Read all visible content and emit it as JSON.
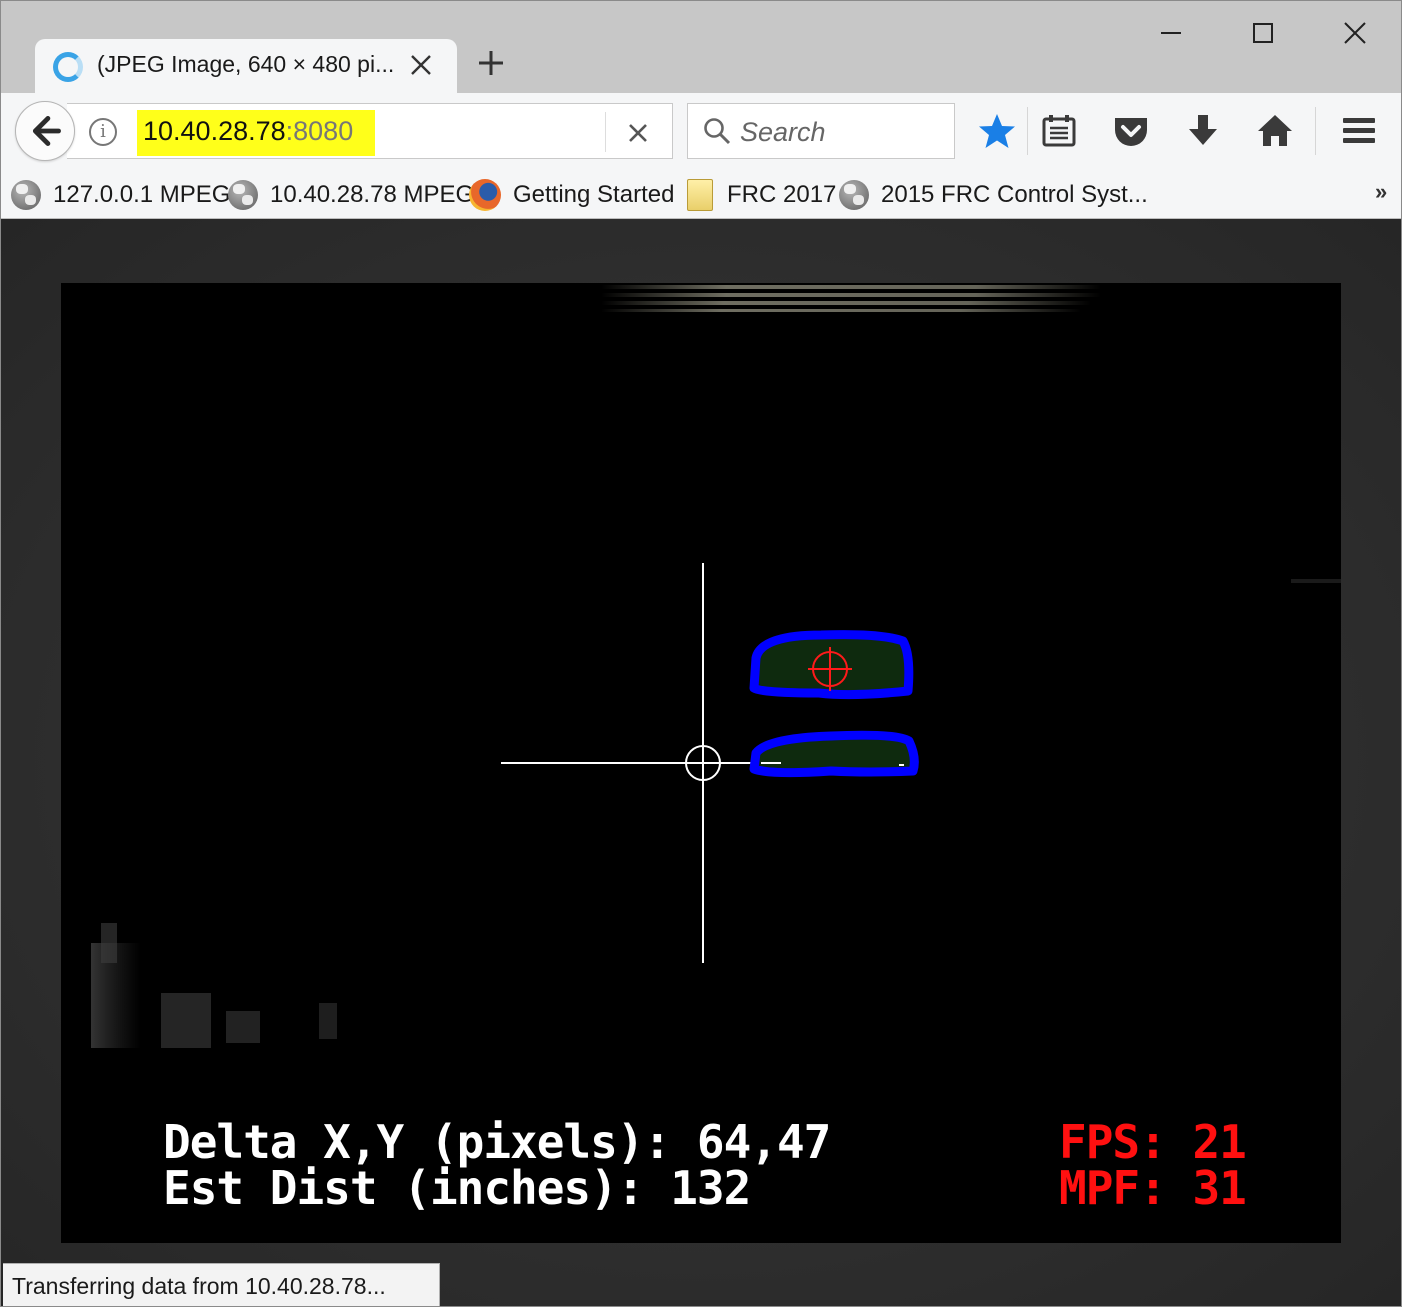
{
  "tab": {
    "title": "(JPEG Image, 640 × 480 pi..."
  },
  "nav": {
    "url_host": "10.40.28.78",
    "url_port": ":8080",
    "search_placeholder": "Search"
  },
  "bookmarks": [
    {
      "label": "127.0.0.1 MPEG",
      "icon": "globe-icon"
    },
    {
      "label": "10.40.28.78 MPEG",
      "icon": "globe-icon"
    },
    {
      "label": "Getting Started",
      "icon": "firefox-icon"
    },
    {
      "label": "FRC 2017",
      "icon": "folder-icon"
    },
    {
      "label": "2015 FRC Control Syst...",
      "icon": "globe-icon"
    }
  ],
  "bookmarks_overflow": "»",
  "camera": {
    "delta_line": "Delta X,Y (pixels): 64,47",
    "dist_line": "Est Dist (inches): 132",
    "fps_line": "FPS: 21",
    "mpf_line": "MPF: 31"
  },
  "status": {
    "text": "Transferring data from 10.40.28.78..."
  },
  "colors": {
    "accent_blue": "#1a7fe6",
    "url_highlight": "#ffff1a",
    "target_outline": "#0000ff",
    "overlay_red": "#ff1010"
  }
}
